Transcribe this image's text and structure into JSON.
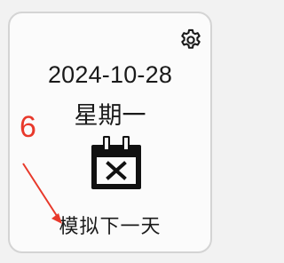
{
  "card": {
    "date": "2024-10-28",
    "weekday": "星期一",
    "simulate_label": "模拟下一天"
  },
  "icons": {
    "settings": "gear-icon",
    "calendar": "calendar-x-icon"
  },
  "annotation": {
    "step_number": "6",
    "color": "#e8392b"
  }
}
